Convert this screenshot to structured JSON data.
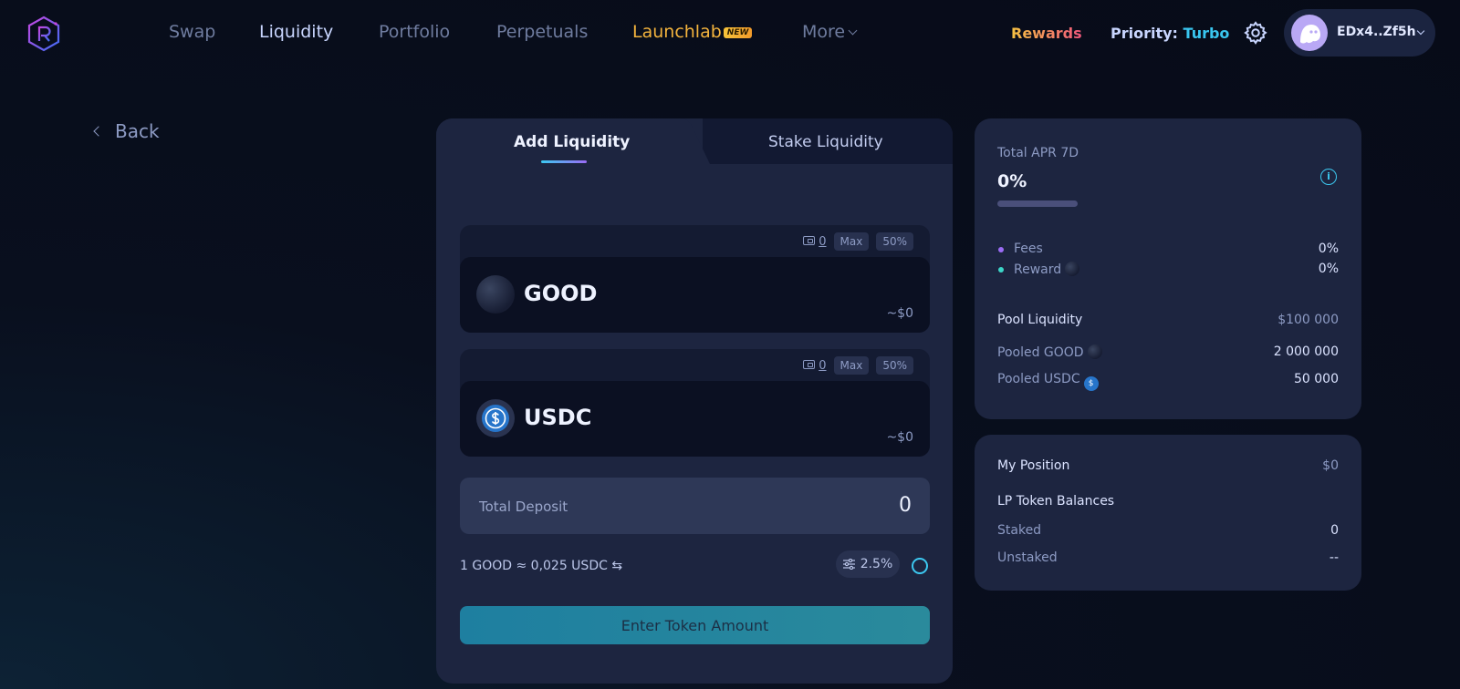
{
  "nav": {
    "items": [
      "Swap",
      "Liquidity",
      "Portfolio",
      "Perpetuals",
      "Launchlab",
      "More"
    ],
    "new_badge": "NEW",
    "rewards": "Rewards",
    "priority_label": "Priority:",
    "priority_value": "Turbo",
    "wallet_address": "EDx4..Zf5h"
  },
  "back_label": "Back",
  "tabs": {
    "add": "Add Liquidity",
    "stake": "Stake Liquidity"
  },
  "tokens": [
    {
      "name": "GOOD",
      "balance": "0",
      "max": "Max",
      "half": "50%",
      "usd": "~$0"
    },
    {
      "name": "USDC",
      "balance": "0",
      "max": "Max",
      "half": "50%",
      "usd": "~$0"
    }
  ],
  "deposit": {
    "label": "Total Deposit",
    "value": "0"
  },
  "rate": "1 GOOD ≈ 0,025 USDC ⇆",
  "slippage": "2.5%",
  "cta": "Enter Token Amount",
  "pool": {
    "apr_label": "Total APR 7D",
    "apr_value": "0%",
    "fees_label": "Fees",
    "fees_value": "0%",
    "reward_label": "Reward",
    "reward_value": "0%",
    "liquidity_label": "Pool Liquidity",
    "liquidity_value": "$100 000",
    "pooled_good_label": "Pooled GOOD",
    "pooled_good_value": "2 000 000",
    "pooled_usdc_label": "Pooled USDC",
    "pooled_usdc_value": "50 000"
  },
  "position": {
    "title": "My Position",
    "value": "$0",
    "lp_label": "LP Token Balances",
    "staked_label": "Staked",
    "staked_value": "0",
    "unstaked_label": "Unstaked",
    "unstaked_value": "--"
  },
  "colors": {
    "accent": "#3cc8f0",
    "purple": "#9b6cf5",
    "launch": "#f3b33d",
    "bg": "#070b18",
    "card": "#1d2540"
  }
}
